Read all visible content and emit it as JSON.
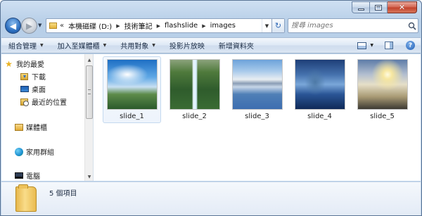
{
  "window": {
    "close_glyph": "✕"
  },
  "nav": {
    "back_glyph": "◀",
    "forward_glyph": "▶",
    "recent_glyph": "▼",
    "overflow_glyph": "«",
    "breadcrumbs": [
      {
        "label": "本機磁碟 (D:)"
      },
      {
        "label": "技術筆記"
      },
      {
        "label": "flashslide"
      },
      {
        "label": "images"
      }
    ],
    "crumb_sep_glyph": "▶",
    "dropdown_glyph": "▼",
    "refresh_glyph": "↻"
  },
  "search": {
    "placeholder": "搜尋 images"
  },
  "toolbar": {
    "commands": [
      {
        "label": "組合管理",
        "has_dropdown": true
      },
      {
        "label": "加入至媒體櫃",
        "has_dropdown": true
      },
      {
        "label": "共用對象",
        "has_dropdown": true
      },
      {
        "label": "投影片放映",
        "has_dropdown": false
      },
      {
        "label": "新增資料夾",
        "has_dropdown": false
      }
    ],
    "dropdown_glyph": "▼",
    "help_glyph": "?"
  },
  "sidebar": {
    "items": [
      {
        "label": "我的最愛",
        "icon": "star-icon"
      },
      {
        "label": "下載",
        "icon": "downloads-folder-icon"
      },
      {
        "label": "桌面",
        "icon": "desktop-icon"
      },
      {
        "label": "最近的位置",
        "icon": "recent-places-icon"
      },
      {
        "label": "媒體櫃",
        "icon": "library-icon"
      },
      {
        "label": "家用群組",
        "icon": "homegroup-icon"
      },
      {
        "label": "電腦",
        "icon": "computer-icon"
      }
    ],
    "star_glyph": "★",
    "scroll_up_glyph": "▲",
    "scroll_down_glyph": "▼"
  },
  "files": [
    {
      "name": "slide_1",
      "selected": true
    },
    {
      "name": "slide_2",
      "selected": false
    },
    {
      "name": "slide_3",
      "selected": false
    },
    {
      "name": "slide_4",
      "selected": false
    },
    {
      "name": "slide_5",
      "selected": false
    }
  ],
  "details": {
    "item_count": "5 個項目"
  }
}
